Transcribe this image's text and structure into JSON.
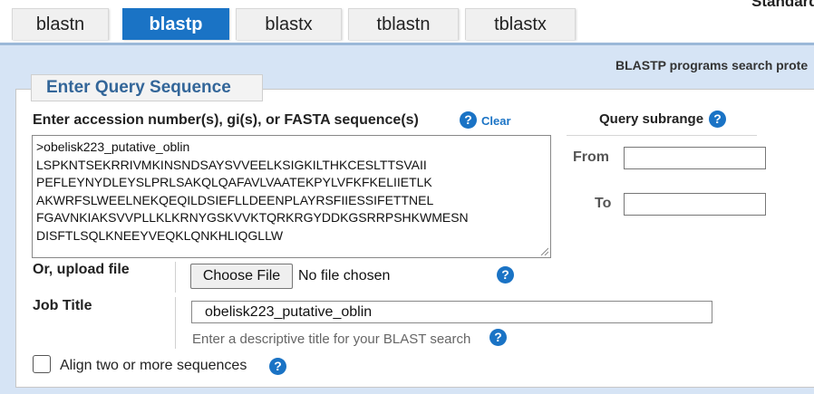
{
  "tabs": [
    {
      "label": "blastn",
      "active": false
    },
    {
      "label": "blastp",
      "active": true
    },
    {
      "label": "blastx",
      "active": false
    },
    {
      "label": "tblastn",
      "active": false
    },
    {
      "label": "tblastx",
      "active": false
    }
  ],
  "header": {
    "standard_label": "Standard"
  },
  "program_description": "BLASTP programs search prote",
  "query": {
    "section_title": "Enter Query Sequence",
    "input_label": "Enter accession number(s), gi(s), or FASTA sequence(s)",
    "clear_label": "Clear",
    "sequence_lines": [
      ">obelisk223_putative_oblin",
      "LSPKNTSEKRRIVMKINSNDSAYSVVEELKSIGKILTHKCESLTTSVAII",
      "PEFLEYNYDLEYSLPRLSAKQLQAFAVLVAATEKPYLVFKFKELIIETLK",
      "AKWRFSLWEELNEKQEQILDSIEFLLDEENPLAYRSFIIESSIFETTNEL",
      "FGAVNKIAKSVVPLLKLKRNYGSKVVKTQRKRGYDDKGSRRPSHKWMESN",
      "DISFTLSQLKNEEYVEQKLQNKHLIQGLLW"
    ]
  },
  "subrange": {
    "title": "Query subrange",
    "from_label": "From",
    "from_value": "",
    "to_label": "To",
    "to_value": ""
  },
  "upload": {
    "label": "Or, upload file",
    "button_label": "Choose File",
    "status": "No file chosen"
  },
  "job": {
    "label": "Job Title",
    "value": "obelisk223_putative_oblin",
    "hint": "Enter a descriptive title for your BLAST search"
  },
  "align": {
    "label": "Align two or more sequences",
    "checked": false
  },
  "colors": {
    "accent": "#1a73c5",
    "panel_bg": "#d6e4f5",
    "legend_text": "#336699"
  },
  "icons": {
    "help": "question-circle-icon"
  }
}
